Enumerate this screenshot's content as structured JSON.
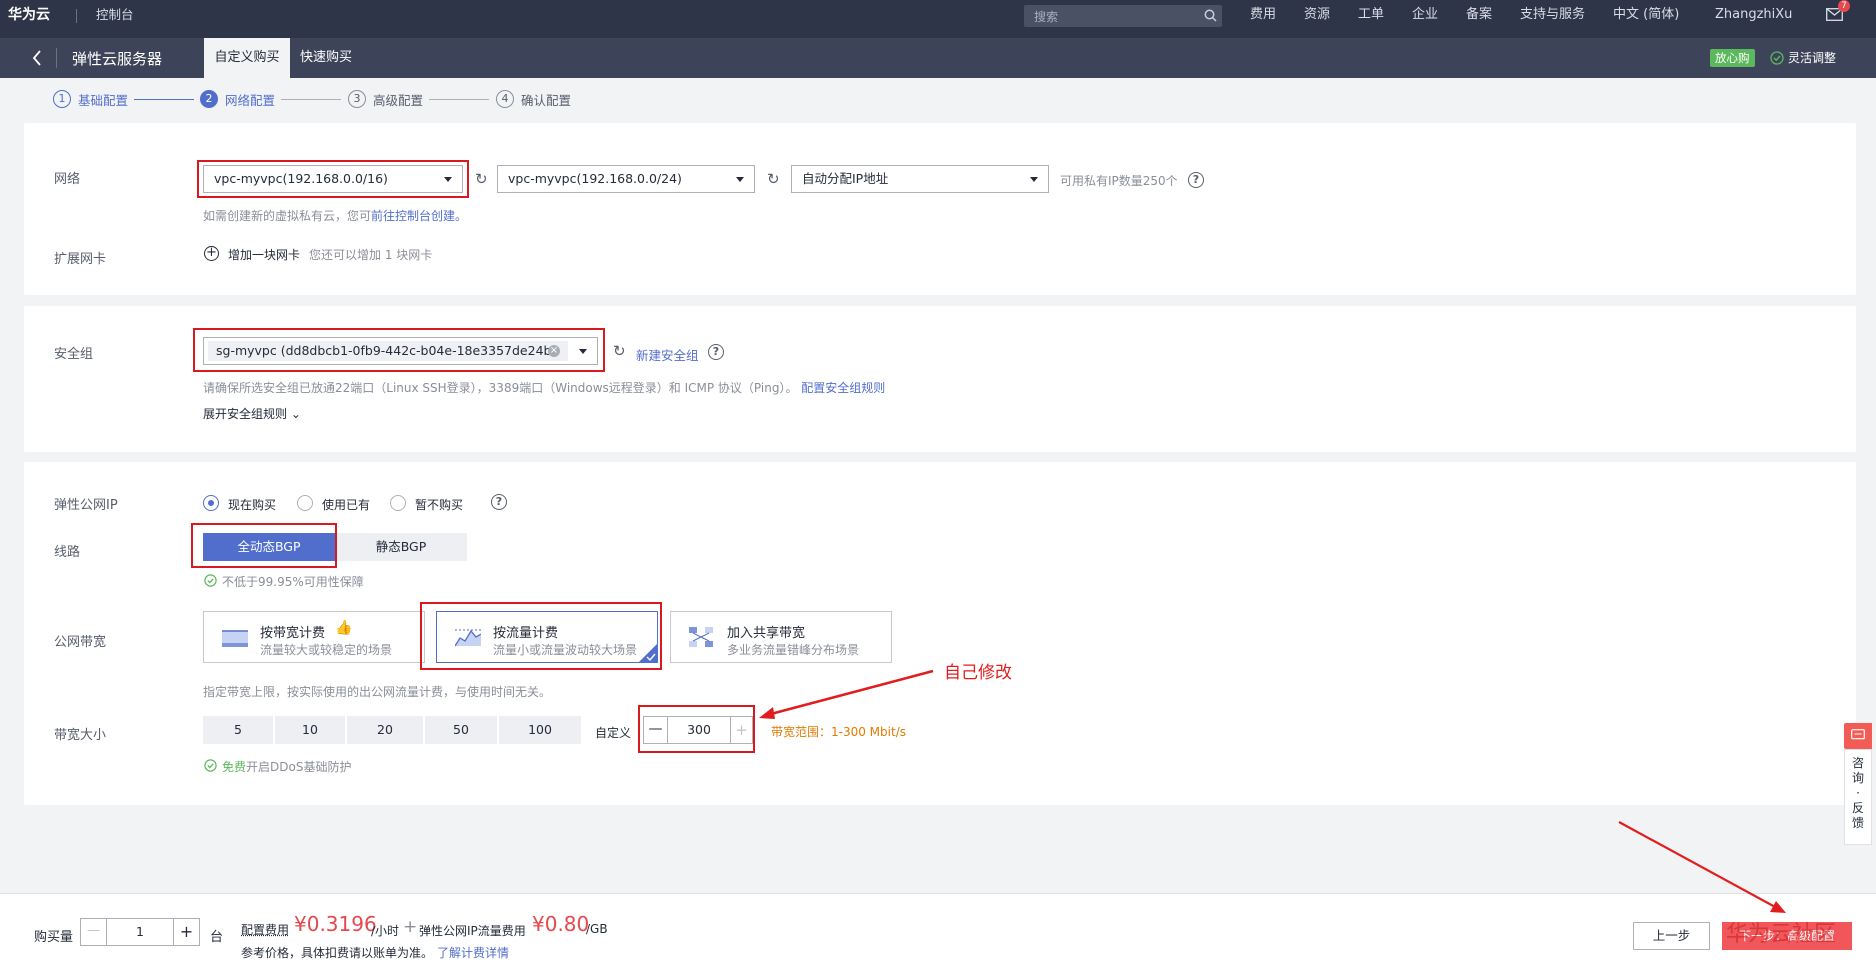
{
  "topbar": {
    "brand": "华为云",
    "console": "控制台",
    "search_placeholder": "搜索",
    "nav": [
      "费用",
      "资源",
      "工单",
      "企业",
      "备案",
      "支持与服务",
      "中文 (简体)",
      "ZhangzhiXu"
    ],
    "mail_badge": "7"
  },
  "subbar": {
    "title": "弹性云服务器",
    "tabs": [
      "自定义购买",
      "快速购买"
    ],
    "badge": "放心购",
    "flex": "灵活调整"
  },
  "steps": [
    {
      "num": "1",
      "label": "基础配置"
    },
    {
      "num": "2",
      "label": "网络配置"
    },
    {
      "num": "3",
      "label": "高级配置"
    },
    {
      "num": "4",
      "label": "确认配置"
    }
  ],
  "network": {
    "label": "网络",
    "vpc": "vpc-myvpc(192.168.0.0/16)",
    "subnet": "vpc-myvpc(192.168.0.0/24)",
    "ip_mode": "自动分配IP地址",
    "ip_count": "可用私有IP数量250个",
    "hint_prefix": "如需创建新的虚拟私有云，您可",
    "hint_link": "前往控制台创建。",
    "nic_label": "扩展网卡",
    "nic_add": "增加一块网卡",
    "nic_hint": "您还可以增加 1 块网卡"
  },
  "security": {
    "label": "安全组",
    "value": "sg-myvpc (dd8dbcb1-0fb9-442c-b04e-18e3357de24b)",
    "new_link": "新建安全组",
    "hint": "请确保所选安全组已放通22端口（Linux SSH登录），3389端口（Windows远程登录）和 ICMP 协议（Ping）。",
    "hint_link": "配置安全组规则",
    "expand": "展开安全组规则"
  },
  "eip": {
    "label": "弹性公网IP",
    "options": [
      "现在购买",
      "使用已有",
      "暂不购买"
    ],
    "line_label": "线路",
    "lines": [
      "全动态BGP",
      "静态BGP"
    ],
    "availability": "不低于99.95%可用性保障",
    "bw_label": "公网带宽",
    "bw_cards": [
      {
        "title": "按带宽计费",
        "sub": "流量较大或较稳定的场景"
      },
      {
        "title": "按流量计费",
        "sub": "流量小或流量波动较大场景"
      },
      {
        "title": "加入共享带宽",
        "sub": "多业务流量错峰分布场景"
      }
    ],
    "bw_hint": "指定带宽上限，按实际使用的出公网流量计费，与使用时间无关。",
    "size_label": "带宽大小",
    "sizes": [
      "5",
      "10",
      "20",
      "50",
      "100"
    ],
    "custom": "自定义",
    "custom_value": "300",
    "range": "带宽范围：1-300 Mbit/s",
    "ddos_free": "免费",
    "ddos_rest": "开启DDoS基础防护"
  },
  "annotation": "自己修改",
  "feedback": [
    "咨",
    "询",
    "·",
    "反",
    "馈"
  ],
  "bottom": {
    "qty_label": "购买量",
    "qty": "1",
    "unit": "台",
    "fee_label": "配置费用",
    "price": "¥0.3196",
    "price_unit": "/小时",
    "plus": "+",
    "eip_fee_label": "弹性公网IP流量费用",
    "eip_price": "¥0.80",
    "eip_unit": "/GB",
    "note": "参考价格，具体扣费请以账单为准。",
    "note_link": "了解计费详情",
    "prev": "上一步",
    "next": "下一步：高级配置",
    "watermark": "华为云社区"
  }
}
